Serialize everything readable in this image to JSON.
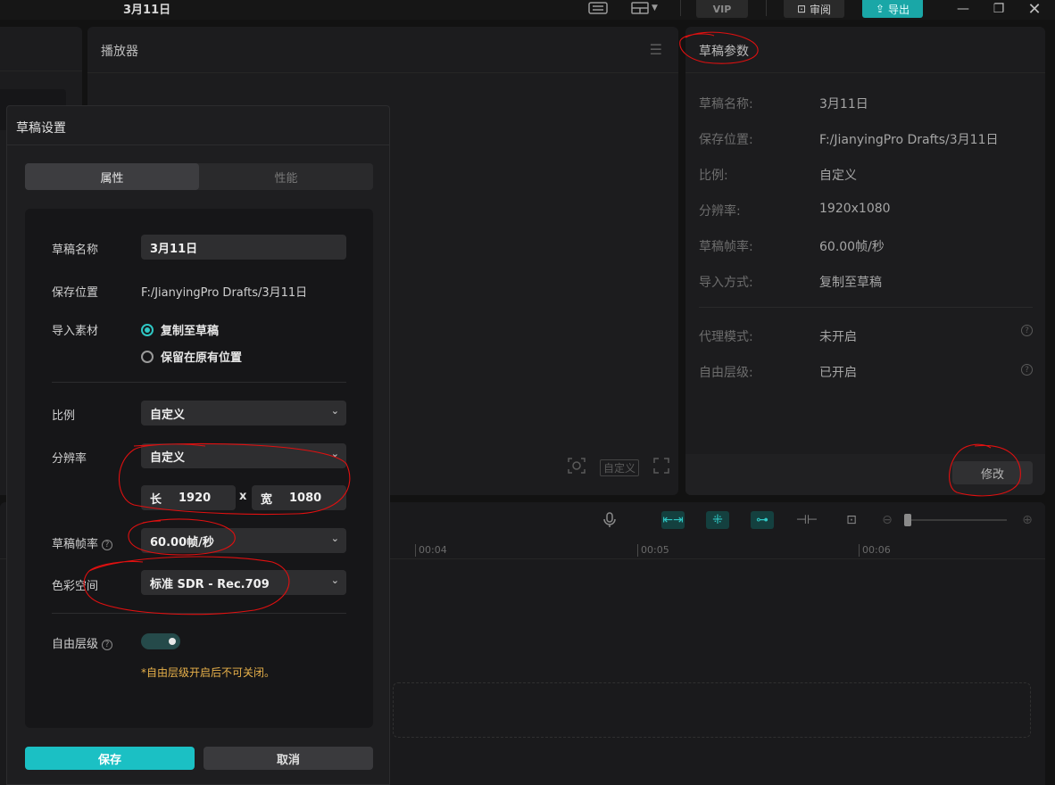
{
  "window": {
    "title": "3月11日",
    "vip_label": "VIP",
    "review_label": "审阅",
    "export_label": "导出"
  },
  "player": {
    "title": "播放器",
    "ratio_label": "自定义"
  },
  "params": {
    "title": "草稿参数",
    "rows": [
      {
        "label": "草稿名称:",
        "value": "3月11日"
      },
      {
        "label": "保存位置:",
        "value": "F:/JianyingPro Drafts/3月11日"
      },
      {
        "label": "比例:",
        "value": "自定义"
      },
      {
        "label": "分辨率:",
        "value": "1920x1080"
      },
      {
        "label": "草稿帧率:",
        "value": "60.00帧/秒"
      },
      {
        "label": "导入方式:",
        "value": "复制至草稿"
      },
      {
        "label": "代理模式:",
        "value": "未开启"
      },
      {
        "label": "自由层级:",
        "value": "已开启"
      }
    ],
    "modify_label": "修改"
  },
  "timeline": {
    "ticks": [
      "00:04",
      "00:05",
      "00:06"
    ]
  },
  "dialog": {
    "title": "草稿设置",
    "tabs": [
      {
        "label": "属性",
        "active": true
      },
      {
        "label": "性能",
        "active": false
      }
    ],
    "name_label": "草稿名称",
    "name_value": "3月11日",
    "path_label": "保存位置",
    "path_value": "F:/JianyingPro Drafts/3月11日",
    "import_label": "导入素材",
    "import_options": [
      {
        "label": "复制至草稿",
        "selected": true
      },
      {
        "label": "保留在原有位置",
        "selected": false
      }
    ],
    "ratio_label": "比例",
    "ratio_value": "自定义",
    "resolution_label": "分辨率",
    "resolution_value": "自定义",
    "width_key": "长",
    "width_value": "1920",
    "x_label": "x",
    "height_key": "宽",
    "height_value": "1080",
    "framerate_label": "草稿帧率",
    "framerate_value": "60.00帧/秒",
    "colorspace_label": "色彩空间",
    "colorspace_value": "标准 SDR - Rec.709",
    "layer_label": "自由层级",
    "layer_enabled": true,
    "layer_warning": "*自由层级开启后不可关闭。",
    "save_label": "保存",
    "cancel_label": "取消"
  },
  "colors": {
    "accent": "#1bc0c4",
    "warning": "#e8b14a",
    "annotation": "#e01010"
  }
}
